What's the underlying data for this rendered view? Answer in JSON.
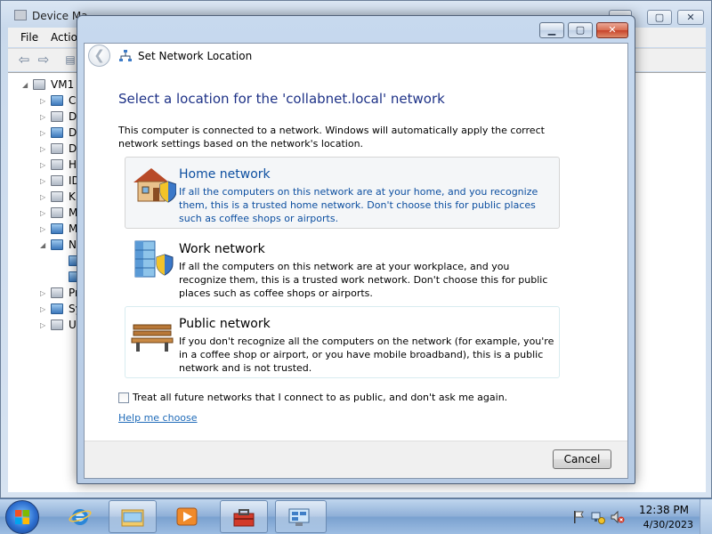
{
  "background_window": {
    "title": "Device Ma",
    "menu": [
      "File",
      "Actio"
    ],
    "tree": {
      "root": "VM1",
      "items": [
        "C",
        "D",
        "D",
        "D",
        "H",
        "ID",
        "K",
        "M",
        "M",
        "N",
        "",
        "",
        "Pr",
        "Sy",
        "U"
      ]
    }
  },
  "dialog": {
    "title": "Set Network Location",
    "heading": "Select a location for the 'collabnet.local' network",
    "intro": "This computer is connected to a network. Windows will automatically apply the correct network settings based on the network's location.",
    "options": [
      {
        "title": "Home network",
        "description": "If all the computers on this network are at your home, and you recognize them, this is a trusted home network.  Don't choose this for public places such as coffee shops or airports.",
        "icon": "house-icon"
      },
      {
        "title": "Work network",
        "description": "If all the computers on this network are at your workplace, and you recognize them, this is a trusted work network.  Don't choose this for public places such as coffee shops or airports.",
        "icon": "office-building-icon"
      },
      {
        "title": "Public network",
        "description": "If you don't recognize all the computers on the network (for example, you're in a coffee shop or airport, or you have mobile broadband), this is a public network and is not trusted.",
        "icon": "park-bench-icon"
      }
    ],
    "checkbox_label": "Treat all future networks that I connect to as public, and don't ask me again.",
    "checkbox_checked": false,
    "help_link": "Help me choose",
    "cancel_label": "Cancel"
  },
  "taskbar": {
    "apps": [
      "internet-explorer-icon",
      "windows-explorer-icon",
      "media-player-icon",
      "toolbox-icon",
      "device-manager-icon"
    ],
    "time": "12:38 PM",
    "date": "4/30/2023"
  },
  "colors": {
    "heading": "#1e3287",
    "link": "#1e6ab8",
    "option_hover_text": "#0d4fa0"
  }
}
